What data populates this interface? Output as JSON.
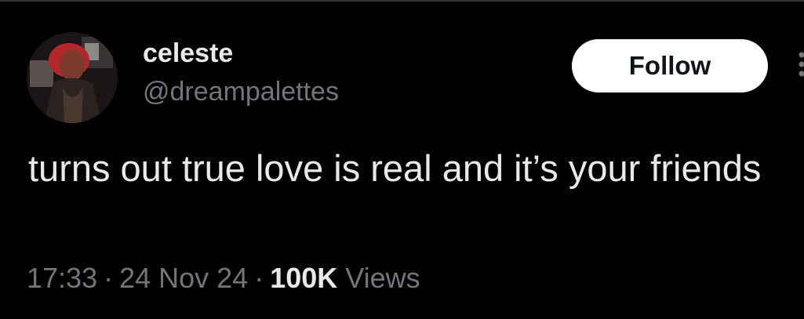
{
  "tweet": {
    "author": {
      "display_name": "celeste",
      "handle": "@dreampalettes",
      "avatar_icon": "profile-photo"
    },
    "follow_label": "Follow",
    "more_icon": "more-vertical-icon",
    "text": "turns out true love is real and it’s your friends",
    "time": "17:33",
    "date": "24 Nov 24",
    "separator": "·",
    "views_count": "100K",
    "views_label": "Views"
  },
  "colors": {
    "background": "#000000",
    "text_primary": "#e7e9ea",
    "text_secondary": "#71767b",
    "follow_bg": "#ffffff",
    "follow_text": "#0f1419"
  }
}
